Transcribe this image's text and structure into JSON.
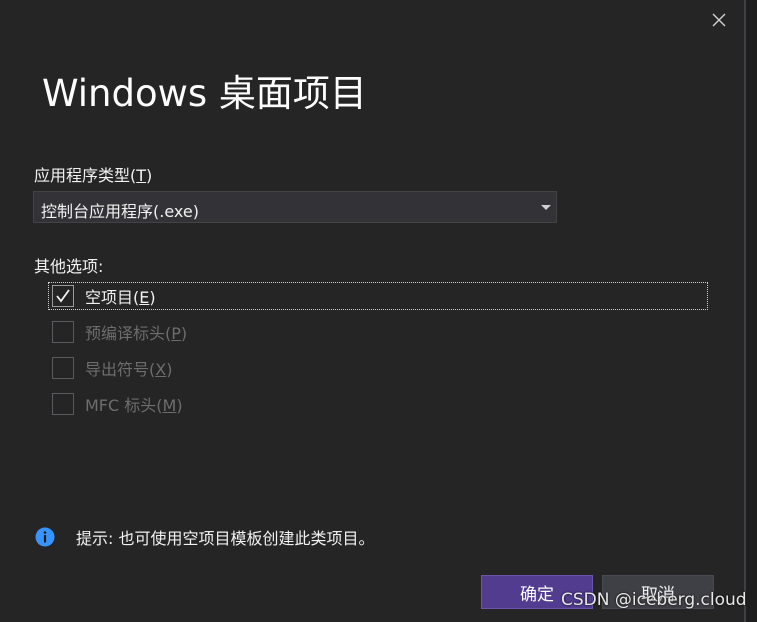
{
  "dialog": {
    "title": "Windows 桌面项目",
    "app_type": {
      "label": "应用程序类型(",
      "mnemonic": "T",
      "label_suffix": ")",
      "selected": "控制台应用程序(.exe)"
    },
    "other_options": {
      "label": "其他选项:",
      "items": [
        {
          "label": "空项目(",
          "mnemonic": "E",
          "suffix": ")",
          "checked": true,
          "enabled": true
        },
        {
          "label": "预编译标头(",
          "mnemonic": "P",
          "suffix": ")",
          "checked": false,
          "enabled": false
        },
        {
          "label": "导出符号(",
          "mnemonic": "X",
          "suffix": ")",
          "checked": false,
          "enabled": false
        },
        {
          "label": "MFC 标头(",
          "mnemonic": "M",
          "suffix": ")",
          "checked": false,
          "enabled": false
        }
      ]
    },
    "hint": "提示: 也可使用空项目模板创建此类项目。",
    "buttons": {
      "ok": "确定",
      "cancel": "取消"
    }
  },
  "watermark": "CSDN @iceberg.cloud",
  "colors": {
    "background": "#252526",
    "accent": "#513c8f",
    "info_icon": "#3794ff"
  },
  "icons": {
    "close": "close-icon",
    "dropdown": "chevron-down-icon",
    "check": "checkmark-icon",
    "info": "info-icon"
  }
}
